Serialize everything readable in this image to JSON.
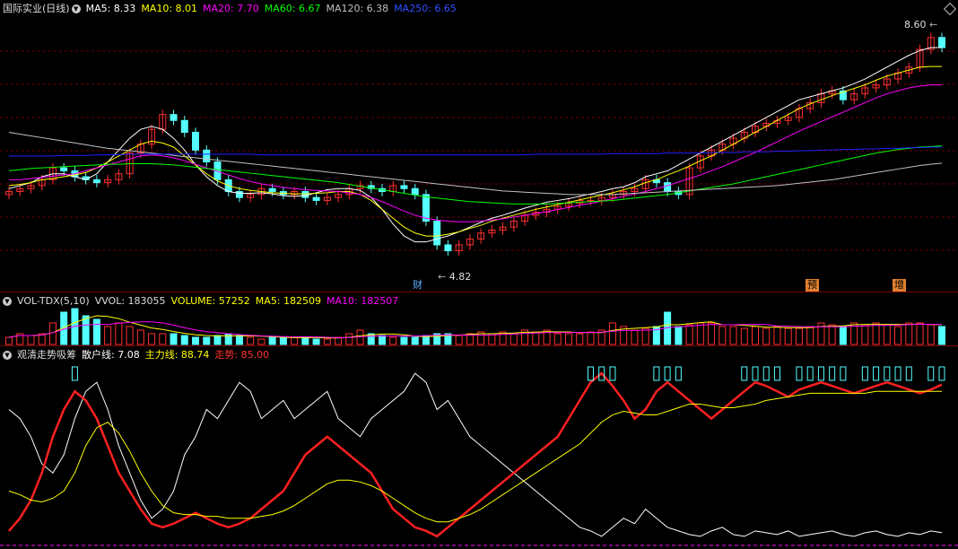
{
  "main": {
    "title": "国际实业(日线)",
    "ma5": "MA5: 8.33",
    "ma10": "MA10: 8.01",
    "ma20": "MA20: 7.70",
    "ma60": "MA60: 6.67",
    "ma120": "MA120: 6.38",
    "ma250": "MA250: 6.65",
    "high_label": "8.60",
    "low_label": "4.82",
    "markers": [
      "财",
      "预",
      "增"
    ],
    "colors": {
      "ma5": "#ffffff",
      "ma10": "#ffff00",
      "ma20": "#ff00ff",
      "ma60": "#00ff00",
      "ma120": "#c0c0c0",
      "ma250": "#2020ff",
      "up": "#ff3030",
      "down": "#54ffff"
    }
  },
  "volume": {
    "title": "VOL-TDX(5,10)",
    "vvol": "VVOL: 183055",
    "volume": "VOLUME: 57252",
    "ma5": "MA5: 182509",
    "ma10": "MA10: 182507"
  },
  "indicator": {
    "title": "观清走势吸筹",
    "retail": "散户线: 7.08",
    "main_force": "主力线: 88.74",
    "trend": "走势: 85.00"
  },
  "chart_data": {
    "type": "line",
    "title": "国际实业(日线)",
    "xlabel": "",
    "ylabel": "",
    "ylim": [
      4.5,
      8.8
    ],
    "grid": true,
    "annotations": [
      {
        "text": "8.60",
        "type": "period-high"
      },
      {
        "text": "4.82",
        "type": "period-low"
      }
    ],
    "close": [
      5.9,
      5.95,
      6.0,
      6.1,
      6.3,
      6.25,
      6.15,
      6.1,
      6.05,
      6.1,
      6.2,
      6.55,
      6.7,
      6.95,
      7.2,
      7.1,
      6.9,
      6.6,
      6.4,
      6.1,
      5.9,
      5.8,
      5.85,
      5.95,
      5.9,
      5.85,
      5.9,
      5.8,
      5.75,
      5.8,
      5.85,
      5.95,
      6.0,
      5.95,
      5.9,
      6.0,
      5.95,
      5.85,
      5.4,
      5.0,
      4.9,
      5.0,
      5.1,
      5.2,
      5.25,
      5.3,
      5.4,
      5.5,
      5.55,
      5.6,
      5.65,
      5.7,
      5.75,
      5.75,
      5.8,
      5.85,
      5.9,
      5.95,
      6.1,
      6.05,
      5.9,
      5.85,
      6.3,
      6.5,
      6.6,
      6.7,
      6.8,
      6.9,
      7.0,
      7.05,
      7.1,
      7.15,
      7.3,
      7.4,
      7.55,
      7.6,
      7.45,
      7.55,
      7.65,
      7.7,
      7.8,
      7.9,
      8.0,
      8.3,
      8.5,
      8.33
    ],
    "volume": [
      0.2,
      0.3,
      0.25,
      0.3,
      0.6,
      0.9,
      1.0,
      0.8,
      0.7,
      0.5,
      0.6,
      0.5,
      0.4,
      0.3,
      0.3,
      0.3,
      0.25,
      0.2,
      0.2,
      0.25,
      0.3,
      0.25,
      0.2,
      0.15,
      0.2,
      0.2,
      0.2,
      0.2,
      0.15,
      0.15,
      0.2,
      0.3,
      0.4,
      0.3,
      0.25,
      0.2,
      0.2,
      0.2,
      0.25,
      0.3,
      0.3,
      0.25,
      0.3,
      0.35,
      0.3,
      0.35,
      0.3,
      0.4,
      0.35,
      0.4,
      0.3,
      0.3,
      0.3,
      0.35,
      0.4,
      0.6,
      0.5,
      0.4,
      0.45,
      0.5,
      0.9,
      0.5,
      0.55,
      0.6,
      0.6,
      0.5,
      0.5,
      0.45,
      0.5,
      0.45,
      0.5,
      0.45,
      0.45,
      0.5,
      0.6,
      0.55,
      0.5,
      0.6,
      0.55,
      0.6,
      0.55,
      0.5,
      0.6,
      0.6,
      0.55,
      0.5
    ],
    "series": [
      {
        "name": "MA5",
        "values": [
          5.95,
          6.0,
          6.05,
          6.15,
          6.2,
          6.2,
          6.15,
          6.1,
          6.2,
          6.4,
          6.6,
          6.8,
          6.95,
          7.0,
          6.95,
          6.8,
          6.6,
          6.35,
          6.15,
          6.0,
          5.9,
          5.87,
          5.87,
          5.88,
          5.86,
          5.83,
          5.82,
          5.83,
          5.88,
          5.93,
          5.95,
          5.95,
          5.92,
          5.8,
          5.6,
          5.35,
          5.15,
          5.05,
          5.05,
          5.1,
          5.15,
          5.22,
          5.3,
          5.38,
          5.45,
          5.5,
          5.56,
          5.62,
          5.67,
          5.72,
          5.75,
          5.78,
          5.82,
          5.86,
          5.9,
          5.95,
          5.98,
          6.05,
          6.15,
          6.2,
          6.25,
          6.35,
          6.45,
          6.55,
          6.65,
          6.75,
          6.85,
          6.95,
          7.05,
          7.15,
          7.25,
          7.35,
          7.45,
          7.5,
          7.55,
          7.6,
          7.65,
          7.72,
          7.8,
          7.9,
          8.0,
          8.1,
          8.2,
          8.28,
          8.33,
          8.33
        ]
      },
      {
        "name": "MA10",
        "values": [
          6.0,
          6.02,
          6.05,
          6.1,
          6.12,
          6.15,
          6.18,
          6.22,
          6.3,
          6.4,
          6.5,
          6.6,
          6.7,
          6.75,
          6.72,
          6.65,
          6.5,
          6.35,
          6.2,
          6.08,
          6.0,
          5.95,
          5.92,
          5.9,
          5.88,
          5.87,
          5.86,
          5.86,
          5.87,
          5.88,
          5.9,
          5.9,
          5.85,
          5.75,
          5.6,
          5.45,
          5.3,
          5.2,
          5.15,
          5.15,
          5.18,
          5.22,
          5.28,
          5.33,
          5.4,
          5.45,
          5.5,
          5.55,
          5.6,
          5.64,
          5.68,
          5.72,
          5.76,
          5.8,
          5.84,
          5.88,
          5.93,
          5.98,
          6.05,
          6.1,
          6.18,
          6.25,
          6.33,
          6.42,
          6.5,
          6.6,
          6.7,
          6.8,
          6.9,
          7.0,
          7.1,
          7.2,
          7.3,
          7.38,
          7.45,
          7.52,
          7.58,
          7.64,
          7.7,
          7.78,
          7.85,
          7.9,
          7.95,
          8.0,
          8.01,
          8.01
        ]
      },
      {
        "name": "MA20",
        "values": [
          6.1,
          6.1,
          6.12,
          6.14,
          6.16,
          6.18,
          6.2,
          6.25,
          6.3,
          6.35,
          6.4,
          6.45,
          6.5,
          6.52,
          6.5,
          6.47,
          6.42,
          6.36,
          6.3,
          6.24,
          6.18,
          6.12,
          6.07,
          6.03,
          6.0,
          5.97,
          5.95,
          5.93,
          5.92,
          5.91,
          5.9,
          5.88,
          5.85,
          5.8,
          5.73,
          5.65,
          5.57,
          5.5,
          5.45,
          5.42,
          5.4,
          5.39,
          5.39,
          5.4,
          5.42,
          5.44,
          5.47,
          5.5,
          5.53,
          5.56,
          5.6,
          5.63,
          5.67,
          5.7,
          5.74,
          5.78,
          5.82,
          5.86,
          5.9,
          5.95,
          6.0,
          6.06,
          6.12,
          6.18,
          6.25,
          6.32,
          6.4,
          6.48,
          6.56,
          6.65,
          6.74,
          6.83,
          6.92,
          7.0,
          7.08,
          7.16,
          7.24,
          7.32,
          7.4,
          7.48,
          7.55,
          7.6,
          7.65,
          7.68,
          7.7,
          7.7
        ]
      },
      {
        "name": "MA60",
        "values": [
          6.25,
          6.27,
          6.29,
          6.3,
          6.31,
          6.32,
          6.33,
          6.34,
          6.35,
          6.36,
          6.36,
          6.37,
          6.37,
          6.37,
          6.36,
          6.35,
          6.33,
          6.31,
          6.29,
          6.27,
          6.25,
          6.23,
          6.21,
          6.19,
          6.17,
          6.15,
          6.13,
          6.11,
          6.09,
          6.07,
          6.05,
          6.02,
          5.99,
          5.96,
          5.93,
          5.9,
          5.87,
          5.84,
          5.81,
          5.79,
          5.77,
          5.75,
          5.73,
          5.72,
          5.71,
          5.7,
          5.69,
          5.69,
          5.69,
          5.69,
          5.7,
          5.71,
          5.72,
          5.73,
          5.74,
          5.75,
          5.77,
          5.79,
          5.81,
          5.83,
          5.85,
          5.88,
          5.91,
          5.94,
          5.97,
          6.0,
          6.03,
          6.07,
          6.11,
          6.15,
          6.19,
          6.23,
          6.27,
          6.31,
          6.35,
          6.39,
          6.43,
          6.47,
          6.51,
          6.55,
          6.58,
          6.61,
          6.63,
          6.65,
          6.66,
          6.67
        ]
      },
      {
        "name": "MA120",
        "values": [
          6.9,
          6.87,
          6.84,
          6.81,
          6.78,
          6.75,
          6.72,
          6.69,
          6.66,
          6.63,
          6.61,
          6.59,
          6.57,
          6.55,
          6.53,
          6.51,
          6.49,
          6.47,
          6.45,
          6.43,
          6.41,
          6.39,
          6.37,
          6.35,
          6.33,
          6.31,
          6.29,
          6.27,
          6.25,
          6.23,
          6.21,
          6.19,
          6.17,
          6.15,
          6.13,
          6.11,
          6.09,
          6.07,
          6.05,
          6.03,
          6.01,
          5.99,
          5.97,
          5.95,
          5.93,
          5.91,
          5.9,
          5.89,
          5.88,
          5.87,
          5.86,
          5.85,
          5.85,
          5.85,
          5.85,
          5.85,
          5.86,
          5.87,
          5.88,
          5.89,
          5.9,
          5.91,
          5.92,
          5.93,
          5.94,
          5.95,
          5.96,
          5.97,
          5.98,
          5.99,
          6.0,
          6.02,
          6.04,
          6.06,
          6.08,
          6.1,
          6.13,
          6.16,
          6.19,
          6.22,
          6.25,
          6.28,
          6.31,
          6.34,
          6.36,
          6.38
        ]
      },
      {
        "name": "MA250",
        "values": [
          6.5,
          6.5,
          6.5,
          6.5,
          6.5,
          6.51,
          6.51,
          6.51,
          6.52,
          6.52,
          6.52,
          6.53,
          6.53,
          6.53,
          6.53,
          6.53,
          6.53,
          6.53,
          6.53,
          6.53,
          6.53,
          6.53,
          6.53,
          6.52,
          6.52,
          6.52,
          6.52,
          6.52,
          6.52,
          6.52,
          6.52,
          6.52,
          6.52,
          6.52,
          6.52,
          6.52,
          6.52,
          6.52,
          6.52,
          6.52,
          6.52,
          6.52,
          6.52,
          6.52,
          6.52,
          6.52,
          6.52,
          6.52,
          6.53,
          6.53,
          6.53,
          6.53,
          6.53,
          6.53,
          6.53,
          6.54,
          6.54,
          6.54,
          6.54,
          6.54,
          6.55,
          6.55,
          6.55,
          6.55,
          6.56,
          6.56,
          6.56,
          6.57,
          6.57,
          6.57,
          6.58,
          6.58,
          6.59,
          6.59,
          6.6,
          6.6,
          6.61,
          6.61,
          6.62,
          6.62,
          6.63,
          6.63,
          6.64,
          6.64,
          6.65,
          6.65
        ]
      }
    ],
    "indicator_series": [
      {
        "name": "散户线",
        "values": [
          75,
          70,
          60,
          45,
          40,
          50,
          70,
          85,
          90,
          75,
          55,
          40,
          25,
          15,
          20,
          30,
          50,
          60,
          75,
          70,
          80,
          90,
          85,
          70,
          75,
          80,
          70,
          75,
          80,
          85,
          70,
          65,
          60,
          70,
          75,
          80,
          85,
          95,
          90,
          75,
          80,
          70,
          60,
          55,
          50,
          45,
          40,
          35,
          30,
          25,
          20,
          15,
          10,
          8,
          5,
          10,
          15,
          12,
          20,
          15,
          10,
          8,
          6,
          5,
          8,
          10,
          6,
          5,
          8,
          7,
          6,
          8,
          5,
          6,
          7,
          8,
          6,
          5,
          7,
          8,
          6,
          5,
          7,
          6,
          8,
          7.08
        ]
      },
      {
        "name": "主力线",
        "values": [
          8,
          15,
          25,
          40,
          60,
          75,
          85,
          80,
          70,
          55,
          40,
          30,
          20,
          12,
          10,
          12,
          15,
          18,
          15,
          12,
          10,
          12,
          15,
          20,
          25,
          30,
          40,
          50,
          55,
          60,
          55,
          50,
          45,
          40,
          30,
          20,
          15,
          10,
          8,
          5,
          10,
          15,
          20,
          25,
          30,
          35,
          40,
          45,
          50,
          55,
          60,
          70,
          80,
          90,
          95,
          88,
          80,
          70,
          75,
          85,
          90,
          85,
          80,
          75,
          70,
          75,
          80,
          85,
          90,
          88,
          85,
          82,
          86,
          88,
          90,
          88,
          86,
          84,
          86,
          88,
          90,
          88,
          86,
          84,
          86,
          88.74
        ]
      },
      {
        "name": "走势",
        "values": [
          30,
          28,
          25,
          24,
          26,
          30,
          40,
          55,
          65,
          68,
          62,
          52,
          40,
          30,
          22,
          18,
          17,
          17,
          16,
          16,
          15,
          15,
          15,
          16,
          17,
          19,
          22,
          26,
          30,
          34,
          36,
          36,
          35,
          33,
          30,
          26,
          22,
          18,
          15,
          13,
          13,
          15,
          17,
          20,
          24,
          28,
          32,
          36,
          40,
          44,
          48,
          52,
          56,
          62,
          68,
          72,
          74,
          73,
          72,
          72,
          74,
          76,
          78,
          78,
          77,
          76,
          76,
          77,
          78,
          80,
          81,
          82,
          83,
          84,
          84,
          84,
          84,
          84,
          84,
          85,
          85,
          85,
          85,
          85,
          85,
          85
        ]
      }
    ]
  }
}
